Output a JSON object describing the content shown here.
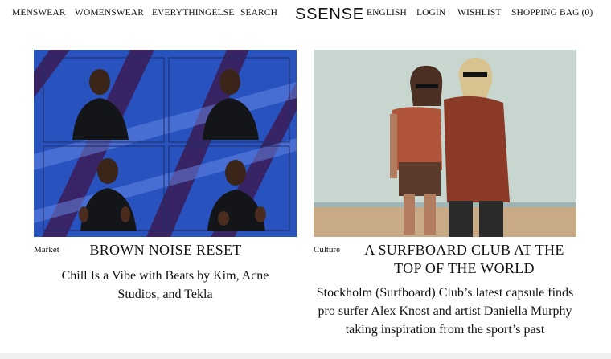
{
  "nav": {
    "left": [
      "MENSWEAR",
      "WOMENSWEAR",
      "EVERYTHINGELSE",
      "SEARCH"
    ],
    "logo": "SSENSE",
    "right": [
      "ENGLISH",
      "LOGIN",
      "WISHLIST",
      "SHOPPING BAG (0)"
    ]
  },
  "articles": [
    {
      "category": "Market",
      "title": "BROWN NOISE RESET",
      "description": "Chill Is a Vibe with Beats by Kim, Acne Studios, and Tekla"
    },
    {
      "category": "Culture",
      "title": "A SURFBOARD CLUB AT THE TOP OF THE WORLD",
      "description": "Stockholm (Surfboard) Club’s latest capsule finds pro surfer Alex Knost and artist Daniella Murphy taking inspiration from the sport’s past"
    }
  ],
  "colors": {
    "text": "#111111",
    "background": "#ffffff",
    "left_image_blue": "#2f5fd0",
    "left_image_stripe": "#3a1f5c",
    "right_image_sky": "#c7d6cf",
    "right_image_sand": "#c9aa86"
  }
}
